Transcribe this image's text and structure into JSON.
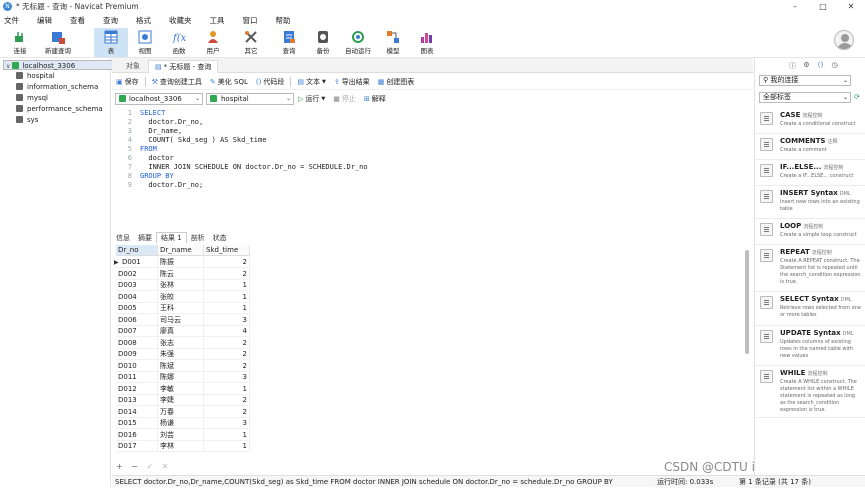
{
  "window": {
    "title": "* 无标题 - 查询 - Navicat Premium",
    "controls": [
      "–",
      "□",
      "✕"
    ]
  },
  "menu": [
    "文件",
    "编辑",
    "查看",
    "查询",
    "格式",
    "收藏夹",
    "工具",
    "窗口",
    "帮助"
  ],
  "toolbar": [
    {
      "label": "连接",
      "icon": "connection-icon",
      "color": "#2e9d53"
    },
    {
      "label": "新建查询",
      "icon": "new-query-icon",
      "color": "#d04a3a"
    },
    {
      "label": "表",
      "icon": "table-icon",
      "color": "#3a7bd5"
    },
    {
      "label": "视图",
      "icon": "view-icon",
      "color": "#3a7bd5"
    },
    {
      "label": "函数",
      "icon": "function-icon",
      "color": "#3a7bd5"
    },
    {
      "label": "用户",
      "icon": "user-icon",
      "color": "#e09a2a"
    },
    {
      "label": "其它",
      "icon": "other-icon",
      "color": "#e07a2a"
    },
    {
      "label": "查询",
      "icon": "query-icon",
      "color": "#3a7bd5"
    },
    {
      "label": "备份",
      "icon": "backup-icon",
      "color": "#555555"
    },
    {
      "label": "自动运行",
      "icon": "automation-icon",
      "color": "#2e9d53"
    },
    {
      "label": "模型",
      "icon": "model-icon",
      "color": "#e07a2a"
    },
    {
      "label": "图表",
      "icon": "chart-icon",
      "color": "#b03ab0"
    }
  ],
  "nav": {
    "connection": "localhost_3306",
    "databases": [
      "hospital",
      "information_schema",
      "mysql",
      "performance_schema",
      "sys"
    ]
  },
  "tabs": {
    "object": "对象",
    "query": "* 无标题 - 查询"
  },
  "query_toolbar": [
    "保存",
    "查询创建工具",
    "美化 SQL",
    "代码段",
    "文本",
    "导出结果",
    "创建图表"
  ],
  "selectors": {
    "connection": "localhost_3306",
    "database": "hospital",
    "run": "运行",
    "stop": "停止",
    "explain": "解释"
  },
  "editor": {
    "line_numbers": [
      "1",
      "2",
      "3",
      "4",
      "5",
      "6",
      "7",
      "8",
      "9"
    ],
    "lines": [
      {
        "kw": "SELECT",
        "rest": ""
      },
      {
        "kw": "",
        "rest": "  doctor.Dr_no,"
      },
      {
        "kw": "",
        "rest": "  Dr_name,"
      },
      {
        "kw": "",
        "rest": "  COUNT( Skd_seg ) AS Skd_time"
      },
      {
        "kw": "FROM",
        "rest": ""
      },
      {
        "kw": "",
        "rest": "  doctor"
      },
      {
        "kw": "",
        "rest": "  INNER JOIN SCHEDULE ON doctor.Dr_no = SCHEDULE.Dr_no"
      },
      {
        "kw": "GROUP BY",
        "rest": ""
      },
      {
        "kw": "",
        "rest": "  doctor.Dr_no;"
      }
    ]
  },
  "result_tabs": [
    "信息",
    "摘要",
    "结果 1",
    "剖析",
    "状态"
  ],
  "result": {
    "columns": [
      "Dr_no",
      "Dr_name",
      "Skd_time"
    ],
    "rows": [
      [
        "D001",
        "陈振",
        "2"
      ],
      [
        "D002",
        "陈云",
        "2"
      ],
      [
        "D003",
        "张林",
        "1"
      ],
      [
        "D004",
        "张皎",
        "1"
      ],
      [
        "D005",
        "王科",
        "1"
      ],
      [
        "D006",
        "司马云",
        "3"
      ],
      [
        "D007",
        "廖真",
        "4"
      ],
      [
        "D008",
        "张志",
        "2"
      ],
      [
        "D009",
        "朱强",
        "2"
      ],
      [
        "D010",
        "陈斌",
        "2"
      ],
      [
        "D011",
        "陈娜",
        "3"
      ],
      [
        "D012",
        "李敏",
        "1"
      ],
      [
        "D013",
        "李婕",
        "2"
      ],
      [
        "D014",
        "万春",
        "2"
      ],
      [
        "D015",
        "杨谦",
        "3"
      ],
      [
        "D016",
        "刘芸",
        "1"
      ],
      [
        "D017",
        "李林",
        "1"
      ]
    ]
  },
  "grid_footer": [
    "+",
    "−",
    "✓",
    "✕"
  ],
  "status": {
    "sql": "SELECT    doctor.Dr_no,Dr_name,COUNT(Skd_seg) as Skd_time FROM    doctor    INNER JOIN schedule ON doctor.Dr_no = schedule.Dr_no GROUP BY",
    "runtime": "运行时间: 0.033s",
    "records": "第 1 条记录 (共 17 条)"
  },
  "watermark": "CSDN @CDTU iron fan",
  "right_panel": {
    "connection_select": "我的连接",
    "tag_select": "全部标签",
    "snippets": [
      {
        "title": "CASE",
        "tag": "流程控制",
        "desc": "Create a conditional construct"
      },
      {
        "title": "COMMENTS",
        "tag": "注释",
        "desc": "Create a comment"
      },
      {
        "title": "IF...ELSE...",
        "tag": "流程控制",
        "desc": "Create a IF...ELSE... construct"
      },
      {
        "title": "INSERT Syntax",
        "tag": "DML",
        "desc": "Insert new rows into an existing table"
      },
      {
        "title": "LOOP",
        "tag": "流程控制",
        "desc": "Create a simple loop construct"
      },
      {
        "title": "REPEAT",
        "tag": "流程控制",
        "desc": "Create A REPEAT construct. The Statement list is repeated until the search_condition expression is true."
      },
      {
        "title": "SELECT Syntax",
        "tag": "DML",
        "desc": "Retrieve rows selected from one or more tables"
      },
      {
        "title": "UPDATE Syntax",
        "tag": "DML",
        "desc": "Updates columns of existing rows in the named table with new values"
      },
      {
        "title": "WHILE",
        "tag": "流程控制",
        "desc": "Create A WHILE construct. The statement list within a WHILE statement is repeated as long as the search_condition expression is true."
      }
    ]
  }
}
